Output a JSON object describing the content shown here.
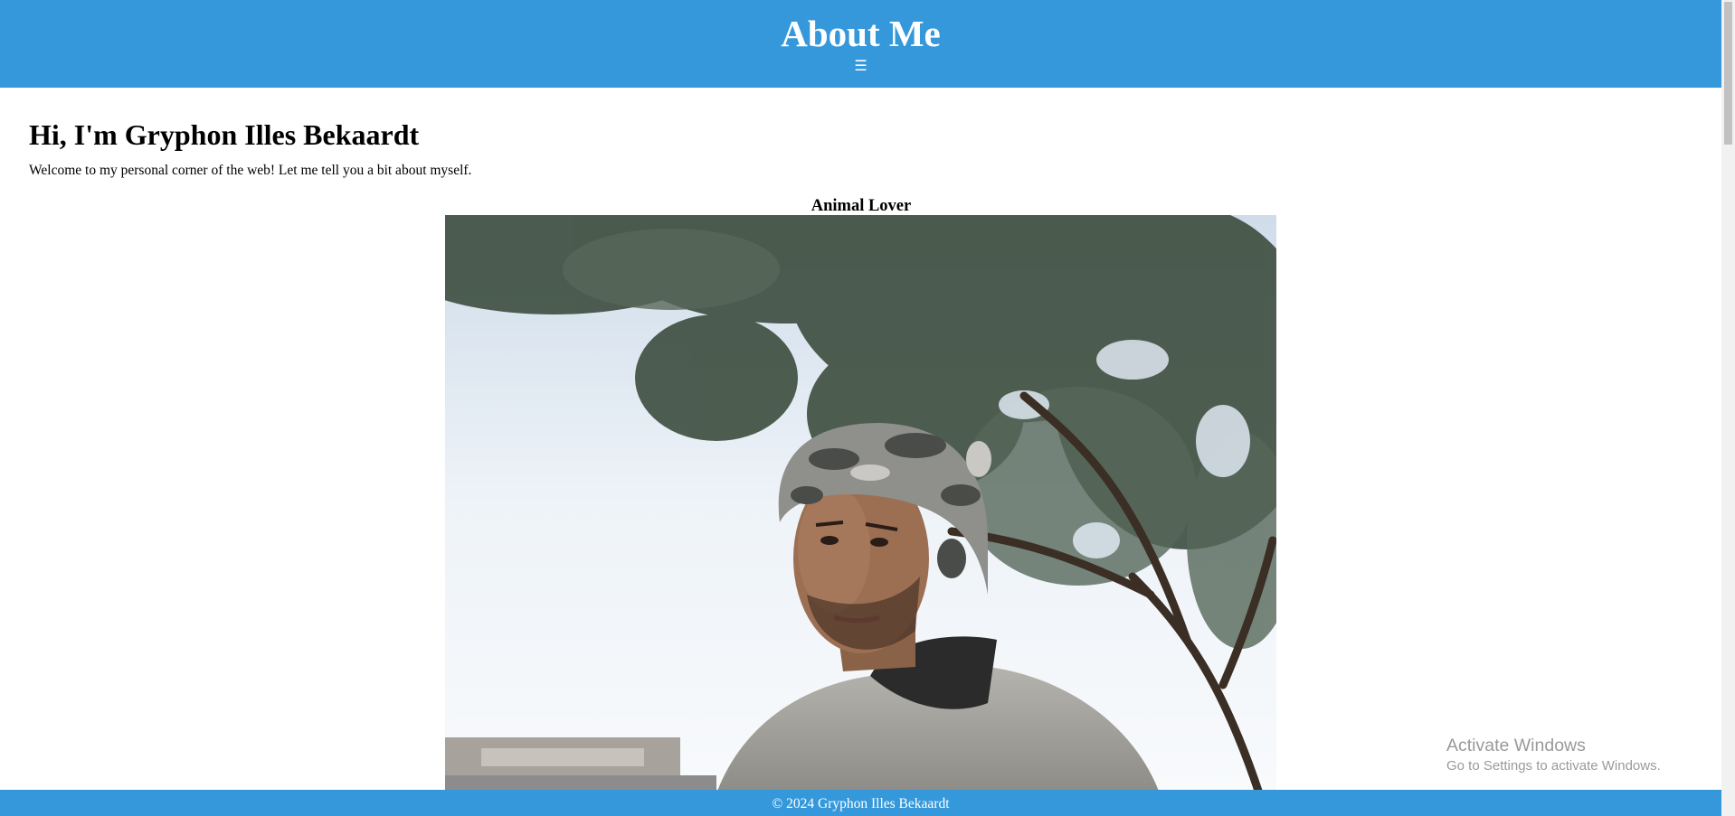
{
  "header": {
    "title": "About Me",
    "menu_icon": "hamburger-menu-icon",
    "menu_glyph": "☰"
  },
  "main": {
    "heading": "Hi, I'm Gryphon Illes Bekaardt",
    "intro": "Welcome to my personal corner of the web! Let me tell you a bit about myself.",
    "sections": [
      {
        "title": "Animal Lover"
      }
    ]
  },
  "footer": {
    "text": "© 2024 Gryphon Illes Bekaardt"
  },
  "os_watermark": {
    "title": "Activate Windows",
    "subtitle": "Go to Settings to activate Windows."
  },
  "colors": {
    "brand": "#3498db",
    "text": "#000000",
    "header_text": "#ffffff"
  }
}
